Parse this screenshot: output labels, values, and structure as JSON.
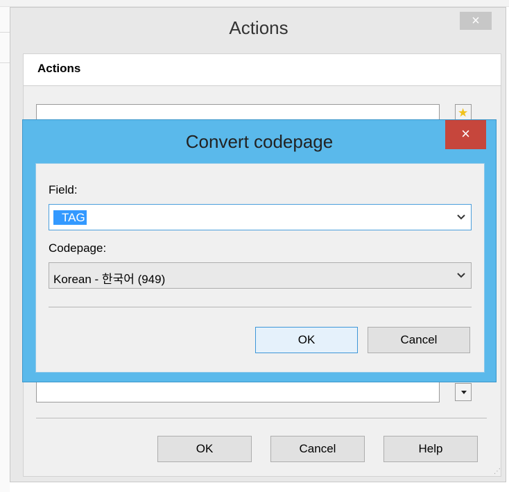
{
  "actions_window": {
    "title": "Actions",
    "close_label": "×",
    "heading": "Actions",
    "buttons": {
      "ok": "OK",
      "cancel": "Cancel",
      "help": "Help"
    }
  },
  "dialog": {
    "title": "Convert codepage",
    "close_label": "×",
    "field_label": "Field:",
    "field_value": "TAG",
    "codepage_label": "Codepage:",
    "codepage_value": "Korean - 한국어 (949)",
    "buttons": {
      "ok": "OK",
      "cancel": "Cancel"
    }
  },
  "colors": {
    "dialog_frame": "#5ab9eb",
    "dialog_close": "#c6463c",
    "selection": "#3399ff"
  },
  "icons": [
    "close-icon",
    "star-icon",
    "arrow-down-icon",
    "chevron-down-icon",
    "resize-grip-icon"
  ]
}
